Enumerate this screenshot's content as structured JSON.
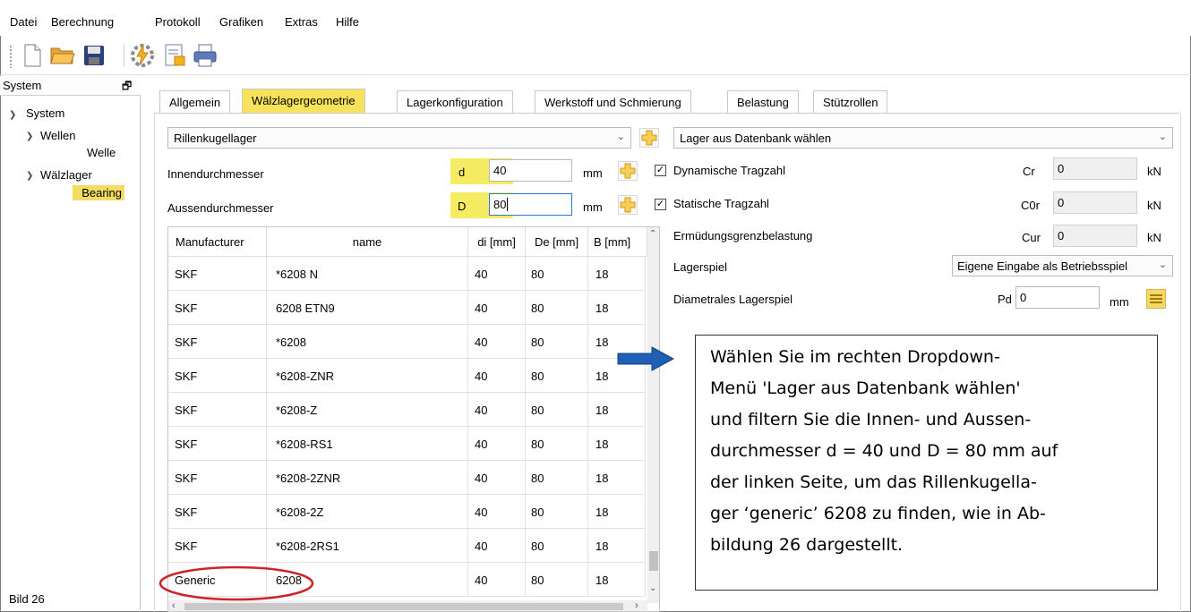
{
  "menu": [
    "Datei",
    "Berechnung",
    "Protokoll",
    "Grafiken",
    "Extras",
    "Hilfe"
  ],
  "toolbar": {
    "icons": [
      "new-file-icon",
      "open-folder-icon",
      "save-icon",
      "calculate-icon",
      "report-icon",
      "print-icon"
    ]
  },
  "tree": {
    "header": "System",
    "pin_glyph": "🗗",
    "root": "System",
    "shafts": "Wellen",
    "shaft": "Welle",
    "bearings": "Wälzlager",
    "bearing": "Bearing"
  },
  "tabs": [
    "Allgemein",
    "Wälzlagergeometrie",
    "Lagerkonfiguration",
    "Werkstoff und Schmierung",
    "Belastung",
    "Stützrollen"
  ],
  "active_tab": "Wälzlagergeometrie",
  "left": {
    "type_combo": "Rillenkugellager",
    "inner_label": "Innendurchmesser",
    "inner_symbol": "d",
    "inner_value": "40",
    "inner_unit": "mm",
    "outer_label": "Aussendurchmesser",
    "outer_symbol": "D",
    "outer_value": "80",
    "outer_unit": "mm"
  },
  "table": {
    "headers": [
      "Manufacturer",
      "name",
      "di [mm]",
      "De [mm]",
      "B [mm]"
    ],
    "rows": [
      [
        "SKF",
        "*6208 N",
        "40",
        "80",
        "18"
      ],
      [
        "SKF",
        "6208 ETN9",
        "40",
        "80",
        "18"
      ],
      [
        "SKF",
        "*6208",
        "40",
        "80",
        "18"
      ],
      [
        "SKF",
        "*6208-ZNR",
        "40",
        "80",
        "18"
      ],
      [
        "SKF",
        "*6208-Z",
        "40",
        "80",
        "18"
      ],
      [
        "SKF",
        "*6208-RS1",
        "40",
        "80",
        "18"
      ],
      [
        "SKF",
        "*6208-2ZNR",
        "40",
        "80",
        "18"
      ],
      [
        "SKF",
        "*6208-2Z",
        "40",
        "80",
        "18"
      ],
      [
        "SKF",
        "*6208-2RS1",
        "40",
        "80",
        "18"
      ],
      [
        "Generic",
        "6208",
        "40",
        "80",
        "18"
      ]
    ]
  },
  "right": {
    "db_combo": "Lager aus Datenbank wählen",
    "dyn_label": "Dynamische Tragzahl",
    "dyn_symbol": "Cr",
    "dyn_value": "0",
    "dyn_unit": "kN",
    "stat_label": "Statische Tragzahl",
    "stat_symbol": "C0r",
    "stat_value": "0",
    "stat_unit": "kN",
    "fatigue_label": "Ermüdungsgrenzbelastung",
    "fatigue_symbol": "Cur",
    "fatigue_value": "0",
    "fatigue_unit": "kN",
    "play_label": "Lagerspiel",
    "play_combo": "Eigene Eingabe als Betriebsspiel",
    "diam_label": "Diametrales Lagerspiel",
    "diam_symbol": "Pd",
    "diam_value": "0",
    "diam_unit": "mm"
  },
  "callout": {
    "lines": [
      "Wählen Sie im rechten Dropdown-",
      "Menü 'Lager aus Datenbank wählen'",
      "und filtern Sie die Innen- und Aussen-",
      "durchmesser d = 40 und D = 80 mm auf",
      "der linken Seite, um das Rillenkugella-",
      "ger ‘generic’ 6208 zu finden, wie in Ab-",
      "bildung 26 dargestellt."
    ]
  },
  "figure_label": "Bild 26",
  "colors": {
    "highlight": "#f6e35b",
    "focus_border": "#2b78d6",
    "arrow": "#1f5fb5",
    "circle": "#c9252b"
  }
}
